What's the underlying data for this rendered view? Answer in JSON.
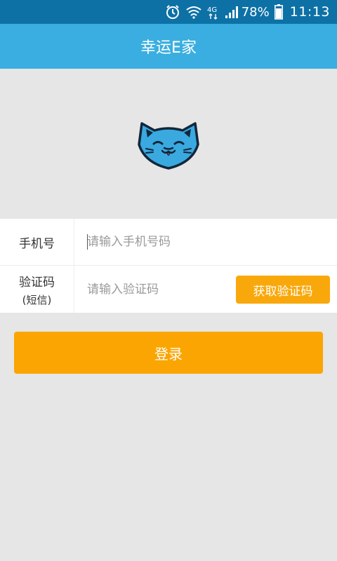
{
  "status_bar": {
    "battery": "78%",
    "time": "11:13",
    "network_label": "4G",
    "icons": [
      "alarm-icon",
      "wifi-icon",
      "network-4g-icon",
      "signal-icon",
      "battery-icon"
    ]
  },
  "app_bar": {
    "title": "幸运E家"
  },
  "logo": {
    "icon": "cat-logo-icon",
    "color": "#39a9e0"
  },
  "form": {
    "phone": {
      "label": "手机号",
      "placeholder": "请输入手机号码",
      "value": ""
    },
    "code": {
      "label": "验证码",
      "sub_label": "(短信)",
      "placeholder": "请输入验证码",
      "value": "",
      "button_label": "获取验证码"
    }
  },
  "login_button_label": "登录",
  "colors": {
    "status_bar": "#0d71a6",
    "app_bar": "#3aaee0",
    "accent": "#fba502",
    "background": "#e6e6e6"
  }
}
